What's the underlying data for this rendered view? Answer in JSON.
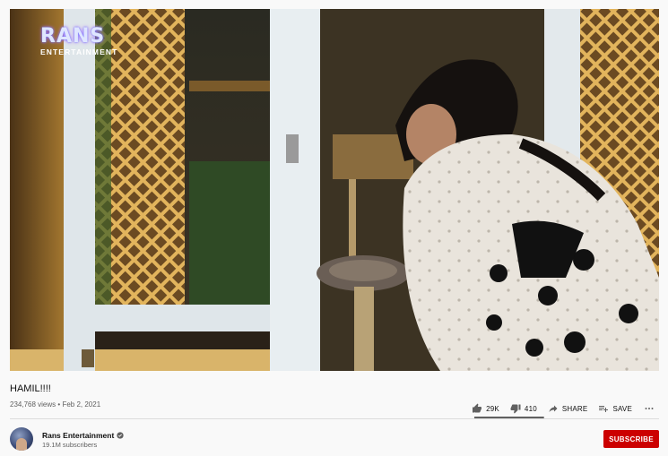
{
  "video": {
    "logo_text": "RANS",
    "logo_subtext": "ENTERTAINMENT"
  },
  "title": "HAMIL!!!!",
  "meta": {
    "views": "234,768 views",
    "separator": "•",
    "date": "Feb 2, 2021"
  },
  "actions": {
    "likes": "29K",
    "dislikes": "410",
    "share": "SHARE",
    "save": "SAVE",
    "like_ratio": 0.986
  },
  "channel": {
    "name": "Rans Entertainment",
    "subscribers": "19.1M subscribers",
    "verified": true
  },
  "subscribe_label": "SUBSCRIBE",
  "colors": {
    "subscribe_bg": "#cc0000",
    "background": "#f9f9f9"
  }
}
